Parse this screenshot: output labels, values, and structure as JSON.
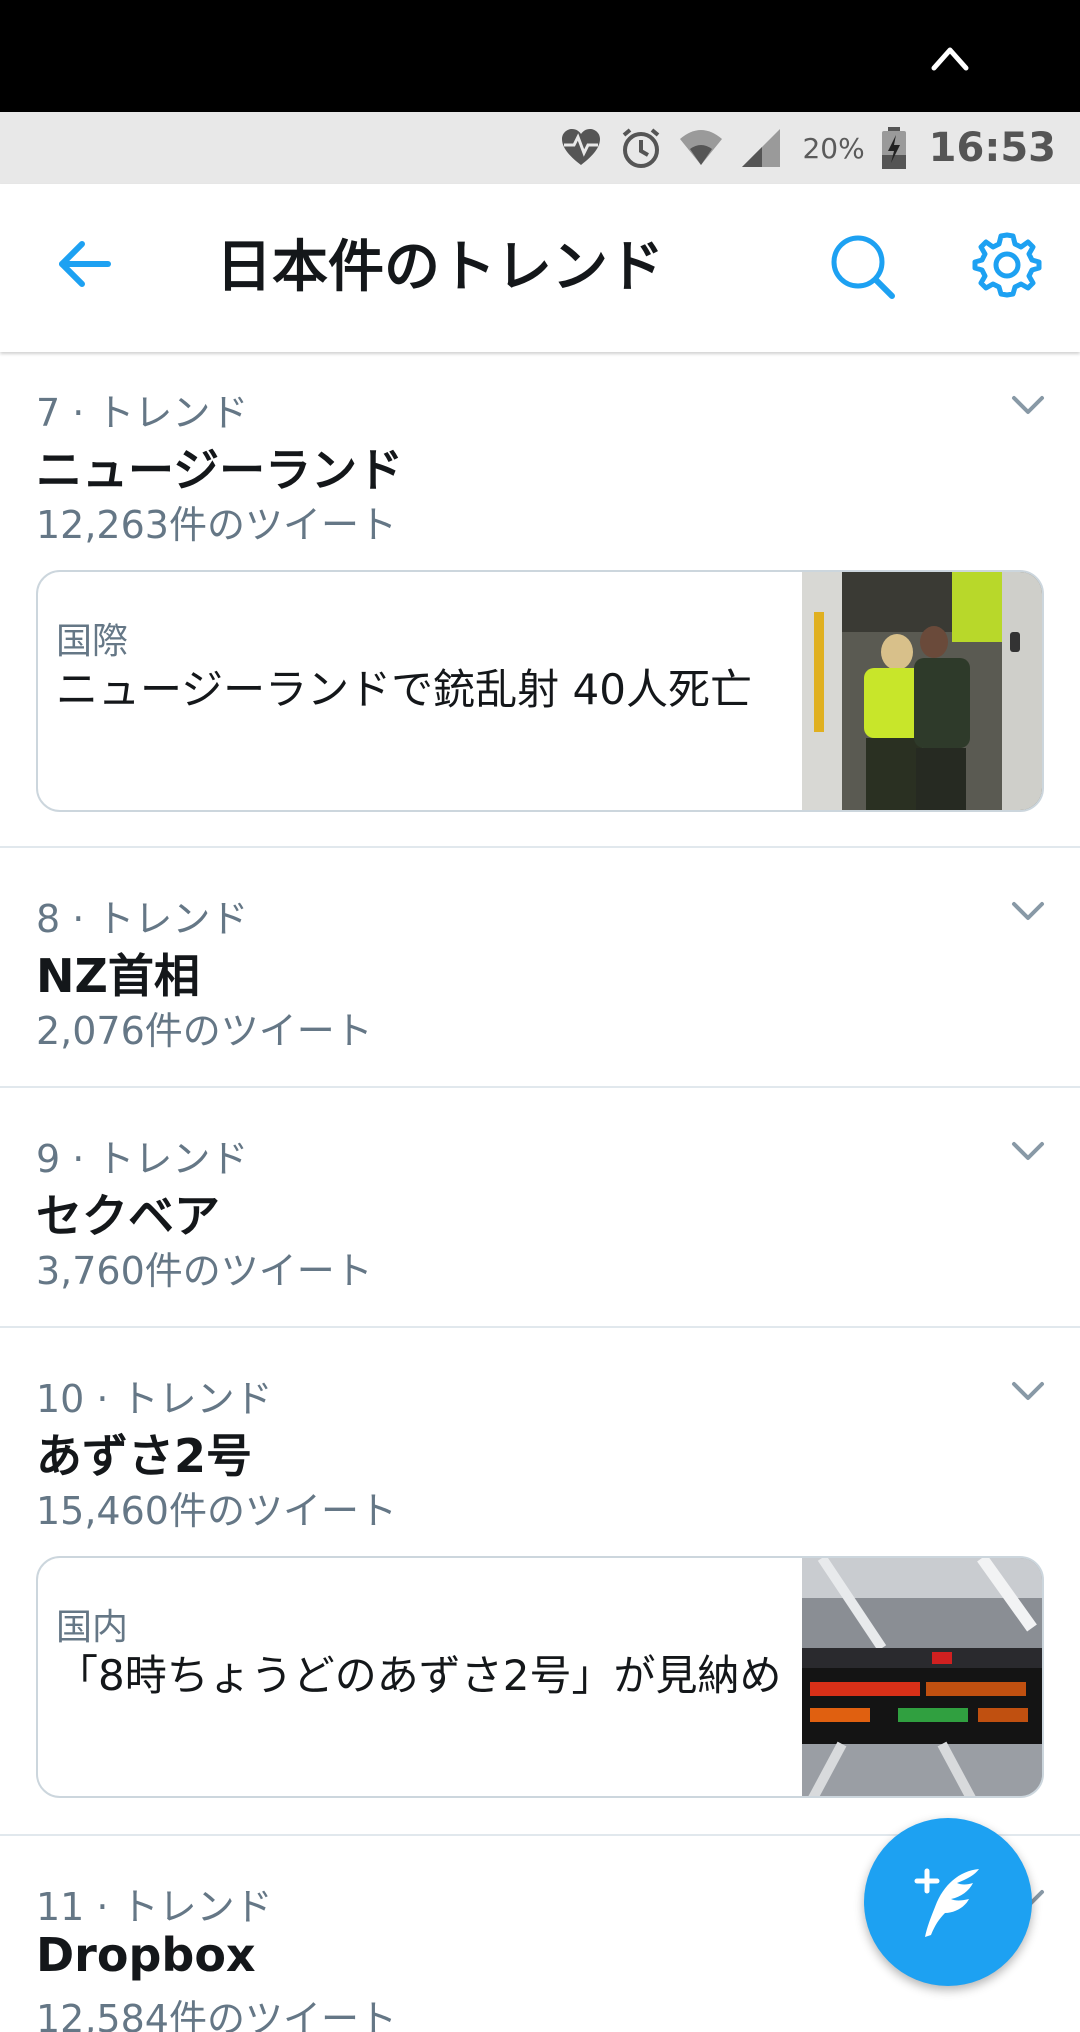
{
  "status_bar": {
    "battery_percent": "20%",
    "time": "16:53"
  },
  "header": {
    "title": "日本件のトレンド"
  },
  "trends": [
    {
      "meta": "7 · トレンド",
      "name": "ニュージーランド",
      "count": "12,263件のツイート",
      "card": {
        "category": "国際",
        "headline": "ニュージーランドで銃乱射 40人死亡"
      }
    },
    {
      "meta": "8 · トレンド",
      "name": "NZ首相",
      "count": "2,076件のツイート"
    },
    {
      "meta": "9 · トレンド",
      "name": "セクベア",
      "count": "3,760件のツイート"
    },
    {
      "meta": "10 · トレンド",
      "name": "あずさ2号",
      "count": "15,460件のツイート",
      "card": {
        "category": "国内",
        "headline": "「8時ちょうどのあずさ2号」が見納め"
      }
    },
    {
      "meta": "11 · トレンド",
      "name": "Dropbox",
      "count": "12,584件のツイート"
    }
  ],
  "colors": {
    "accent": "#1da1f2",
    "secondary_text": "#657786",
    "divider": "#e1e8ed"
  }
}
